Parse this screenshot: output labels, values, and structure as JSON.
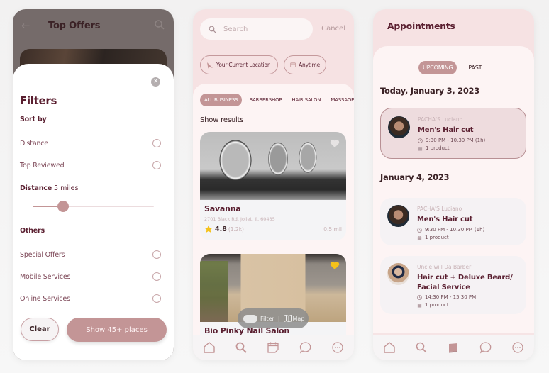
{
  "colors": {
    "primary": "#c39596",
    "text_dark": "#5a1f30",
    "pink_bg": "#f6e2e3",
    "panel_bg": "#fdf4f4",
    "star": "#f5c21a",
    "heart_active": "#f5c21a"
  },
  "filters_screen": {
    "header_title": "Top Offers",
    "back_icon": "arrow-left-icon",
    "search_icon": "search-icon",
    "sheet": {
      "close_icon": "close-icon",
      "title": "Filters",
      "sort_by_label": "Sort by",
      "sort_options": [
        {
          "label": "Distance",
          "selected": false
        },
        {
          "label": "Top Reviewed",
          "selected": false
        }
      ],
      "distance_label": "Distance",
      "distance_value": "5 miles",
      "distance_slider_fraction": 0.25,
      "others_label": "Others",
      "other_options": [
        {
          "label": "Special Offers",
          "selected": false
        },
        {
          "label": "Mobile Services",
          "selected": false
        },
        {
          "label": "Online Services",
          "selected": false
        }
      ],
      "clear_label": "Clear",
      "show_label": "Show 45+ places"
    }
  },
  "search_screen": {
    "search_placeholder": "Search",
    "cancel_label": "Cancel",
    "chips": [
      {
        "label": "Your Current Location",
        "icon": "location-arrow-icon"
      },
      {
        "label": "Anytime",
        "icon": "calendar-icon"
      }
    ],
    "category_tabs": [
      {
        "label": "ALL BUSINESS",
        "active": true
      },
      {
        "label": "BARBERSHOP",
        "active": false
      },
      {
        "label": "HAIR SALON",
        "active": false
      },
      {
        "label": "MASSAGE",
        "active": false
      }
    ],
    "results_heading": "Show results",
    "results": [
      {
        "name": "Savanna",
        "address": "2701 Black Rd, Joliet, Il, 60435",
        "rating": "4.8",
        "reviews": "(1.2k)",
        "distance": "0.5 mil",
        "favorited": false
      },
      {
        "name": "Bio Pinky Nail Salon",
        "favorited": true
      }
    ],
    "floating": {
      "filter_label": "Filter",
      "separator": "|",
      "map_label": "Map"
    },
    "nav": [
      "home-icon",
      "search-icon",
      "calendar-icon",
      "chat-icon",
      "more-icon"
    ]
  },
  "appointments_screen": {
    "title": "Appointments",
    "segments": [
      {
        "label": "UPCOMING",
        "active": true
      },
      {
        "label": "PAST",
        "active": false
      }
    ],
    "groups": [
      {
        "date": "Today, January 3, 2023",
        "items": [
          {
            "shop": "PACHA'S Luciano",
            "service": "Men's Hair cut",
            "time": "9:30 PM - 10.30 PM (1h)",
            "products": "1 product",
            "selected": true
          }
        ]
      },
      {
        "date": "January 4, 2023",
        "items": [
          {
            "shop": "PACHA'S Luciano",
            "service": "Men's Hair cut",
            "time": "9:30 PM - 10.30 PM (1h)",
            "products": "1 product",
            "selected": false
          },
          {
            "shop": "Uncle will Da Barber",
            "service": "Hair cut + Deluxe Beard/ Facial Service",
            "time": "14:30 PM - 15.30 PM",
            "products": "1 product",
            "selected": false
          }
        ]
      }
    ],
    "nav": [
      "home-icon",
      "search-icon",
      "calendar-icon",
      "chat-icon",
      "more-icon"
    ],
    "nav_active": "calendar-icon"
  }
}
